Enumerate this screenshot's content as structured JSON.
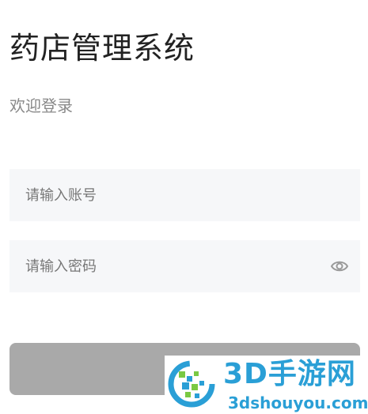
{
  "header": {
    "title": "药店管理系统",
    "subtitle": "欢迎登录"
  },
  "form": {
    "account_placeholder": "请输入账号",
    "account_value": "",
    "password_placeholder": "请输入密码",
    "password_value": "",
    "password_toggle_icon": "eye-icon",
    "login_button_label": ""
  },
  "watermark": {
    "name": "3D手游网",
    "url": "3dshouyou.com",
    "logo_icon": "3dshouyou-logo"
  },
  "colors": {
    "background": "#ffffff",
    "field_background": "#f6f7f9",
    "button_background": "#a9a9a9",
    "title_text": "#222222",
    "subtitle_text": "#888888",
    "watermark_blue": "#2a9fd6",
    "watermark_green": "#7ac943"
  }
}
